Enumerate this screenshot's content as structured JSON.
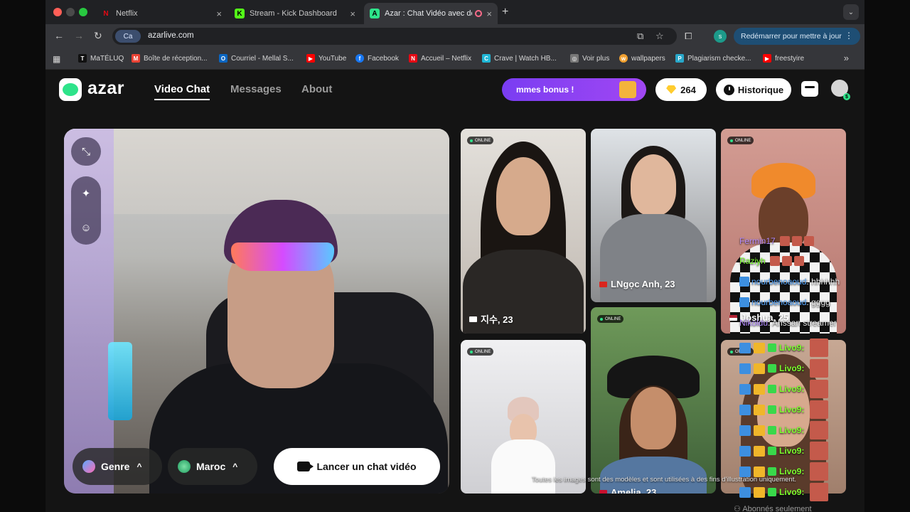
{
  "browser": {
    "tabs": [
      {
        "title": "Netflix",
        "favicon": "N",
        "color": "#e50914"
      },
      {
        "title": "Stream - Kick Dashboard",
        "favicon": "K",
        "color": "#53fc18"
      },
      {
        "title": "Azar : Chat Vidéo avec de",
        "favicon": "A",
        "color": "#2ee38a"
      }
    ],
    "site_chip": "Ca",
    "url": "azarlive.com",
    "restart_label": "Redémarrer pour mettre à jour",
    "profile_initial": "s",
    "bookmarks": [
      {
        "label": "MaTÉLUQ",
        "color": "#111111",
        "letter": "T"
      },
      {
        "label": "Boîte de réception...",
        "color": "#ea4335",
        "letter": "M"
      },
      {
        "label": "Courriel - Mellal S...",
        "color": "#0a66c2",
        "letter": "O"
      },
      {
        "label": "YouTube",
        "color": "#ff0000",
        "letter": "▶"
      },
      {
        "label": "Facebook",
        "color": "#1877f2",
        "letter": "f"
      },
      {
        "label": "Accueil – Netflix",
        "color": "#e50914",
        "letter": "N"
      },
      {
        "label": "Crave | Watch HB...",
        "color": "#1fb7d6",
        "letter": "C"
      },
      {
        "label": "Voir plus",
        "color": "#777777",
        "letter": "◎"
      },
      {
        "label": "wallpapers",
        "color": "#f0a030",
        "letter": "w"
      },
      {
        "label": "Plagiarism checke...",
        "color": "#28a7c9",
        "letter": "P"
      },
      {
        "label": "freestyire",
        "color": "#ff0000",
        "letter": "▶"
      }
    ]
  },
  "header": {
    "logo": "azar",
    "nav": [
      "Video Chat",
      "Messages",
      "About"
    ],
    "bonus": "mmes bonus !",
    "gems": "264",
    "history": "Historique"
  },
  "controls": {
    "gender": "Genre",
    "country": "Maroc",
    "launch": "Lancer un chat vidéo"
  },
  "cards": [
    {
      "online": "ONLINE",
      "name": "지수, 23"
    },
    {
      "online": "",
      "name": "LNgọc Anh, 23"
    },
    {
      "online": "ONLINE",
      "name": "Joshua, 25"
    },
    {
      "online": "ONLINE",
      "name": ""
    },
    {
      "online": "ONLINE",
      "name": "Amelia, 23"
    },
    {
      "online": "ONLINE",
      "name": ""
    }
  ],
  "stream_chat": {
    "lines": [
      {
        "user": "Fermin17",
        "text": ""
      },
      {
        "user": "Raziyh",
        "text": ""
      },
      {
        "user": "nourbenoaoud",
        "text": ": hhhhhh"
      },
      {
        "user": "nourbenoaoud",
        "text": ": gggg"
      },
      {
        "user": "Nikoldu",
        "text": ": Ahssan streamer"
      }
    ],
    "livo_label": "Livo9:",
    "livo_count": 8
  },
  "footer": {
    "disclaimer": "Toutes les images sont des modèles et sont utilisées à des fins d'illustration uniquement.",
    "subscribers": "Abonnés seulement"
  },
  "icons": [
    "collapse-icon",
    "magic-wand-icon",
    "sticker-icon",
    "gender-icon",
    "globe-icon",
    "camera-icon",
    "diamond-icon",
    "clock-icon",
    "shop-icon"
  ]
}
